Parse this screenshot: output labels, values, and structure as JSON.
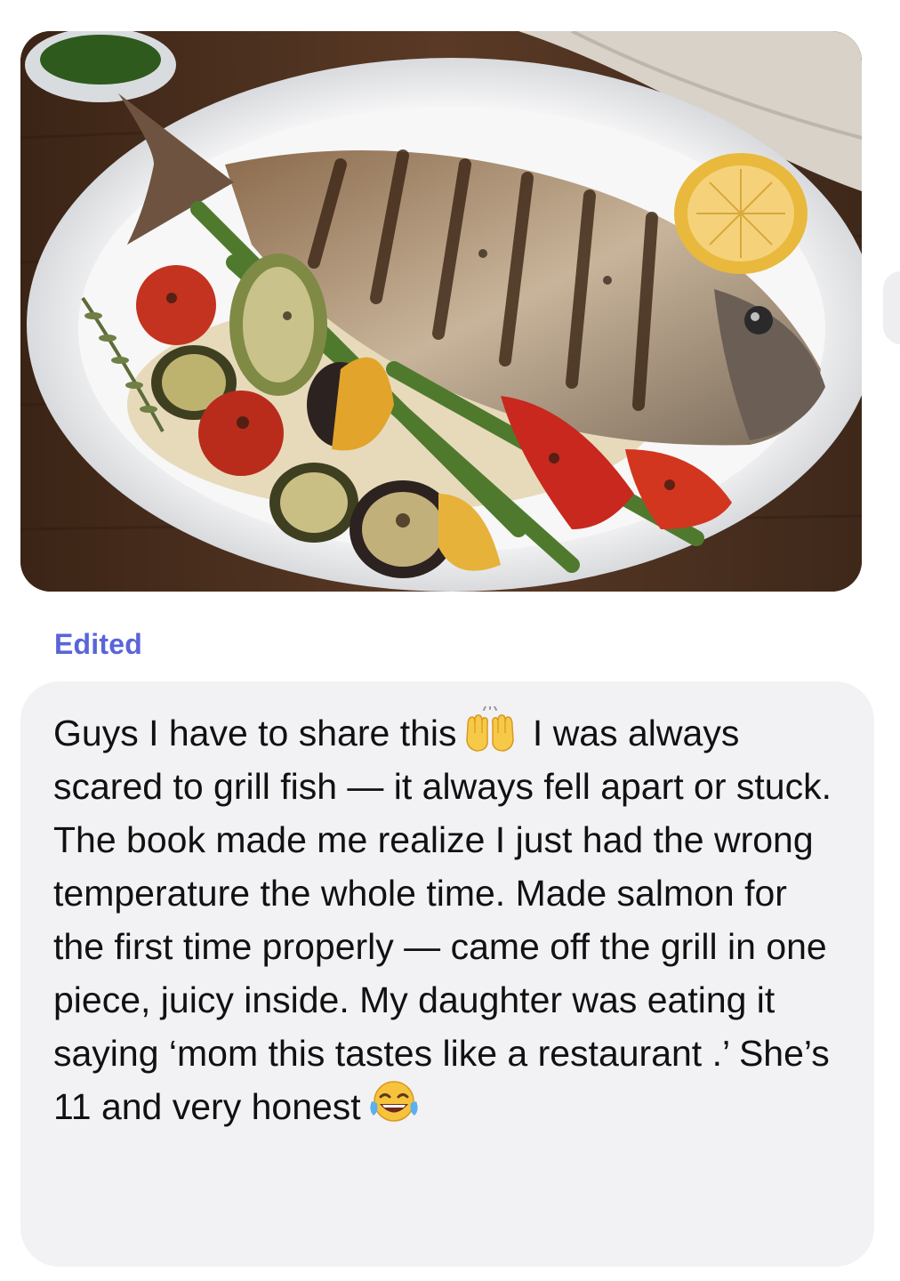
{
  "attachment": {
    "type": "image",
    "alt": "Grilled whole fish with grilled vegetables and lemon on a white oval plate"
  },
  "status_label": "Edited",
  "message": {
    "part1": "Guys I have to share this",
    "emoji1": "raising-hands-emoji",
    "part2": " I was always scared to grill fish — it always fell apart or stuck. The book made me realize I just had the wrong temperature the whole time. Made salmon for the first time properly — came off the grill in one piece, juicy inside. My daughter was eating it saying ‘mom this tastes like a restaurant .’ She’s 11 and very honest",
    "emoji2": "tears-of-joy-emoji"
  },
  "colors": {
    "edited_label": "#5a64d9",
    "bubble_bg": "#f2f2f5",
    "text": "#111111"
  }
}
